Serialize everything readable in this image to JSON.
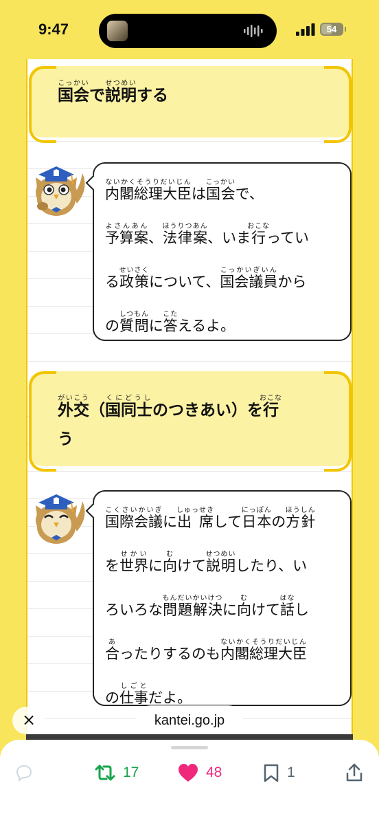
{
  "status_bar": {
    "time": "9:47",
    "battery": "54",
    "battery_level": 0.54
  },
  "heading1": {
    "line": [
      {
        "base": "国会",
        "ruby": "こっかい"
      },
      {
        "base": "で"
      },
      {
        "base": "説明",
        "ruby": "せつめい"
      },
      {
        "base": "する"
      }
    ]
  },
  "bubble1": {
    "lines": [
      [
        {
          "base": "内閣総理大臣",
          "ruby": "ないかくそうりだいじん"
        },
        {
          "base": "は"
        },
        {
          "base": "国会",
          "ruby": "こっかい"
        },
        {
          "base": "で、"
        }
      ],
      [
        {
          "base": "予算案",
          "ruby": "よさんあん"
        },
        {
          "base": "、"
        },
        {
          "base": "法律案",
          "ruby": "ほうりつあん"
        },
        {
          "base": "、いま"
        },
        {
          "base": "行",
          "ruby": "おこな"
        },
        {
          "base": "ってい"
        }
      ],
      [
        {
          "base": "る"
        },
        {
          "base": "政策",
          "ruby": "せいさく"
        },
        {
          "base": "について、"
        },
        {
          "base": "国会議員",
          "ruby": "こっかいぎいん"
        },
        {
          "base": "から"
        }
      ],
      [
        {
          "base": "の"
        },
        {
          "base": "質問",
          "ruby": "しつもん"
        },
        {
          "base": "に"
        },
        {
          "base": "答",
          "ruby": "こた"
        },
        {
          "base": "えるよ。"
        }
      ]
    ]
  },
  "heading2": {
    "lines": [
      [
        {
          "base": "外交",
          "ruby": "がいこう"
        },
        {
          "base": "（"
        },
        {
          "base": "国同士",
          "ruby": "くにどうし"
        },
        {
          "base": "のつきあい）を"
        },
        {
          "base": "行",
          "ruby": "おこな"
        }
      ],
      [
        {
          "base": "う"
        }
      ]
    ]
  },
  "bubble2": {
    "lines": [
      [
        {
          "base": "国際会議",
          "ruby": "こくさいかいぎ"
        },
        {
          "base": "に"
        },
        {
          "base": "出 席",
          "ruby": "しゅっせき"
        },
        {
          "base": "して"
        },
        {
          "base": "日本",
          "ruby": "にっぽん"
        },
        {
          "base": "の"
        },
        {
          "base": "方針",
          "ruby": "ほうしん"
        }
      ],
      [
        {
          "base": "を"
        },
        {
          "base": "世界",
          "ruby": "せかい"
        },
        {
          "base": "に"
        },
        {
          "base": "向",
          "ruby": "む"
        },
        {
          "base": "けて"
        },
        {
          "base": "説明",
          "ruby": "せつめい"
        },
        {
          "base": "したり、い"
        }
      ],
      [
        {
          "base": "ろいろな"
        },
        {
          "base": "問題解決",
          "ruby": "もんだいかいけつ"
        },
        {
          "base": "に"
        },
        {
          "base": "向",
          "ruby": "む"
        },
        {
          "base": "けて"
        },
        {
          "base": "話",
          "ruby": "はな"
        },
        {
          "base": "し"
        }
      ],
      [
        {
          "base": "合",
          "ruby": "あ"
        },
        {
          "base": "ったりするのも"
        },
        {
          "base": "内閣総理大臣",
          "ruby": "ないかくそうりだいじん"
        }
      ],
      [
        {
          "base": "の"
        },
        {
          "base": "仕事",
          "ruby": "しごと"
        },
        {
          "base": "だよ。"
        }
      ]
    ]
  },
  "browser": {
    "close_icon": "×",
    "url": "kantei.go.jp"
  },
  "actions": {
    "retweet_count": "17",
    "like_count": "48",
    "bookmark_count": "1",
    "colors": {
      "retweet": "#17a34a",
      "like": "#f0287c",
      "icon": "#536471"
    }
  }
}
